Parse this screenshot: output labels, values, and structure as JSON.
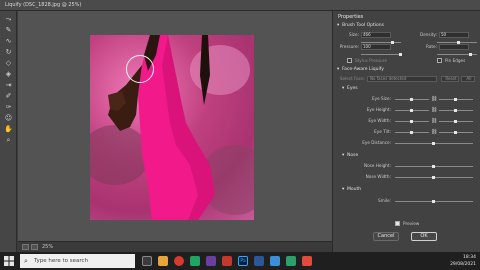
{
  "window": {
    "title": "Liquify (DSC_1828.jpg @ 25%)"
  },
  "tools": {
    "items": [
      "forward-warp",
      "reconstruct",
      "smooth",
      "twirl",
      "pucker",
      "bloat",
      "push-left",
      "freeze-mask",
      "thaw-mask",
      "face",
      "hand",
      "zoom"
    ]
  },
  "status": {
    "zoom": "25%"
  },
  "panel": {
    "title": "Properties",
    "brush_section": "Brush Tool Options",
    "size_label": "Size:",
    "size_value": "466",
    "density_label": "Density:",
    "density_value": "50",
    "pressure_label": "Pressure:",
    "pressure_value": "100",
    "rate_label": "Rate:",
    "rate_value": "",
    "stylus_label": "Stylus Pressure",
    "pin_edges_label": "Pin Edges",
    "face_section": "Face-Aware Liquify",
    "select_face_label": "Select Face:",
    "select_face_value": "No faces detected",
    "reset_label": "Reset",
    "all_label": "All",
    "eyes_section": "Eyes",
    "eye_size": "Eye Size:",
    "eye_height": "Eye Height:",
    "eye_width": "Eye Width:",
    "eye_tilt": "Eye Tilt:",
    "eye_distance": "Eye Distance:",
    "nose_section": "Nose",
    "nose_height": "Nose Height:",
    "nose_width": "Nose Width:",
    "mouth_section": "Mouth",
    "smile": "Smile:",
    "preview_label": "Preview",
    "cancel_label": "Cancel",
    "ok_label": "OK"
  },
  "taskbar": {
    "search_placeholder": "Type here to search",
    "time": "18:34",
    "date": "29/08/2021"
  },
  "colors": {
    "accent": "#e0218a",
    "background": "#3c3c3c"
  }
}
